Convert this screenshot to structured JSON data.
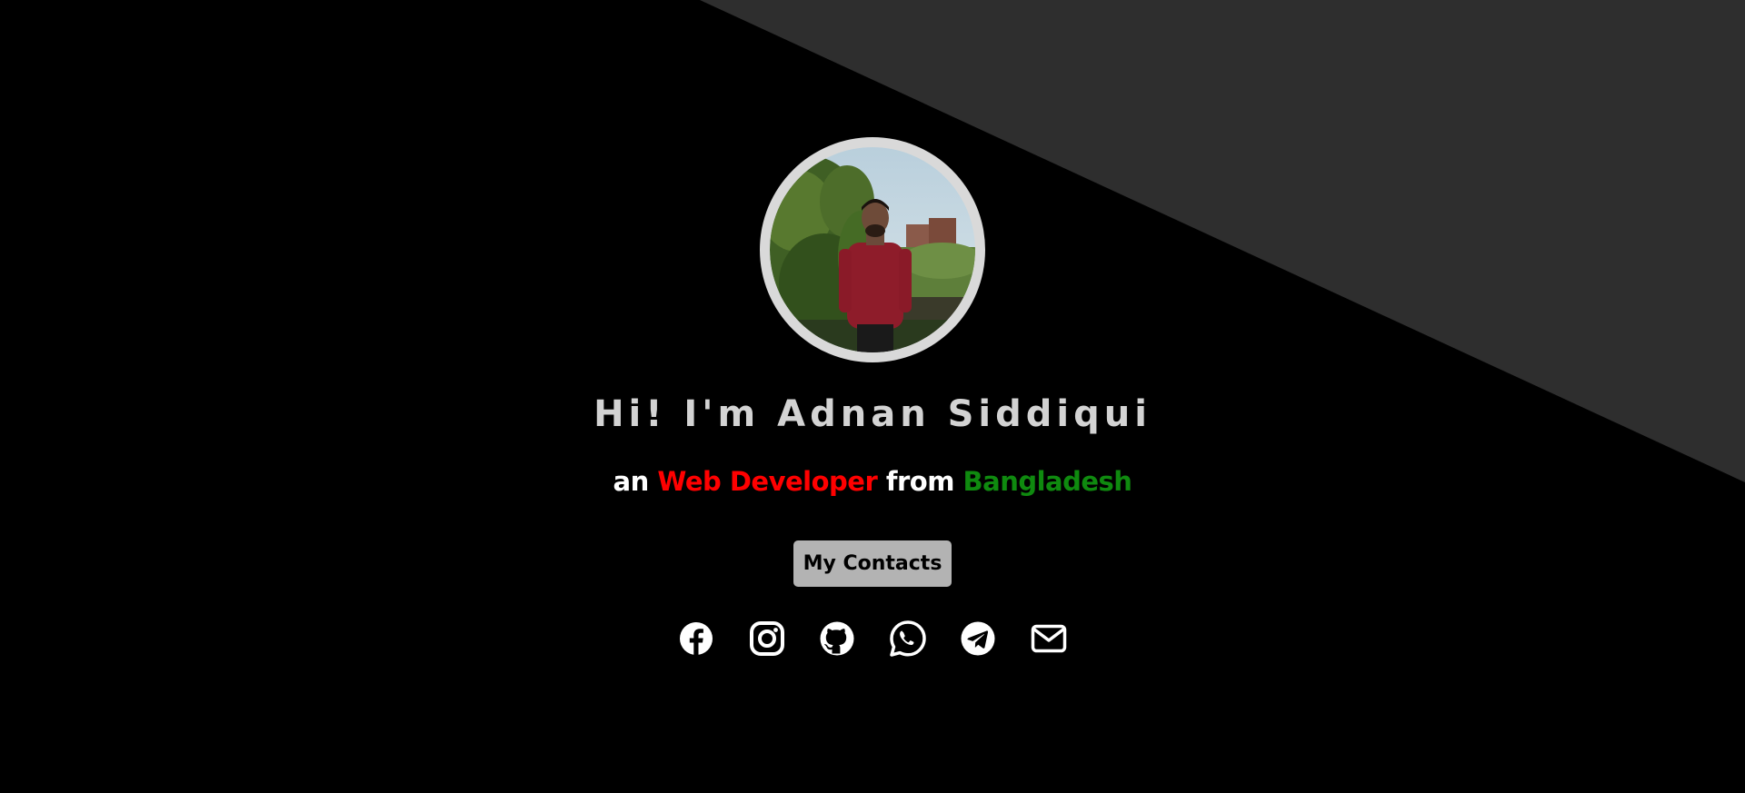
{
  "hero": {
    "title": "Hi! I'm Adnan Siddiqui",
    "subtitle": {
      "prefix": "an",
      "role": "Web Developer",
      "middle": "from",
      "country": "Bangladesh"
    },
    "contacts_button": "My Contacts"
  },
  "social_links": [
    {
      "name": "facebook-icon"
    },
    {
      "name": "instagram-icon"
    },
    {
      "name": "github-icon"
    },
    {
      "name": "whatsapp-icon"
    },
    {
      "name": "telegram-icon"
    },
    {
      "name": "email-icon"
    }
  ],
  "colors": {
    "background": "#000000",
    "diagonal_panel": "#2e2e2e",
    "title": "#d3d3d3",
    "role": "#ff0000",
    "country": "#0f8a0f",
    "button": "#b3b3b3",
    "icons": "#ffffff"
  }
}
